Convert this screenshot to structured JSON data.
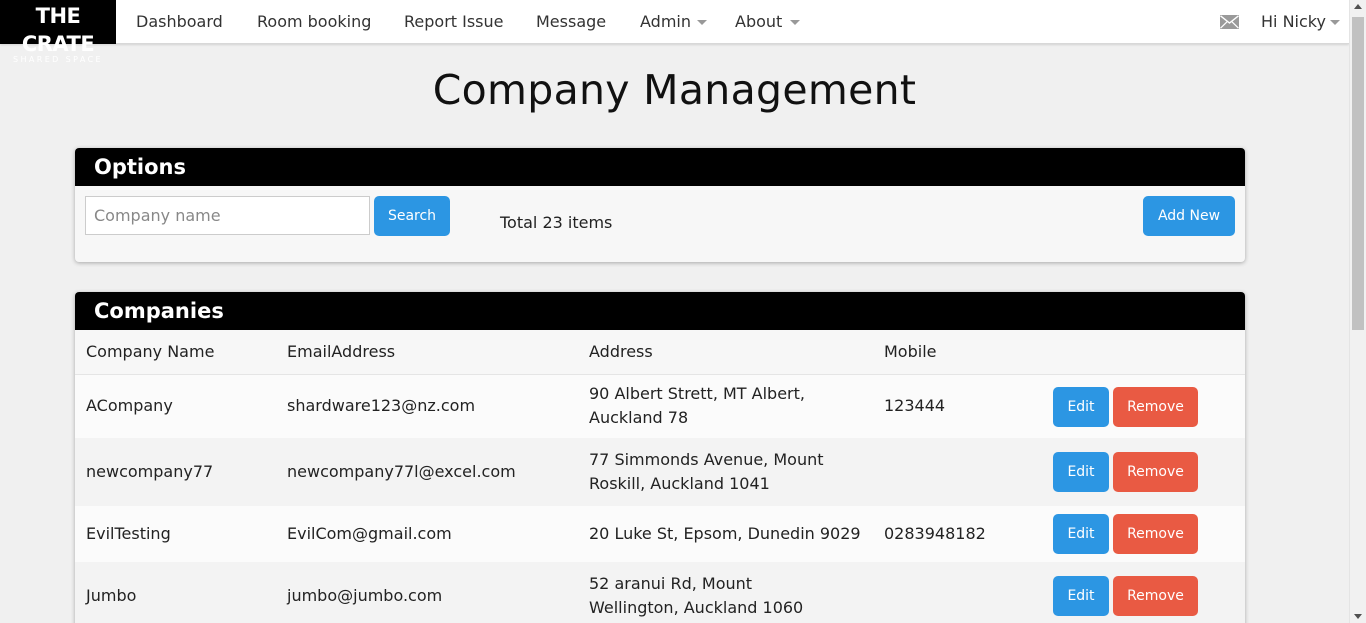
{
  "brand": {
    "line1": "THE CRATE",
    "line2": "SHARED SPACE"
  },
  "nav": {
    "items": [
      {
        "label": "Dashboard"
      },
      {
        "label": "Room booking"
      },
      {
        "label": "Report Issue"
      },
      {
        "label": "Message"
      },
      {
        "label": "Admin"
      },
      {
        "label": "About"
      }
    ],
    "greeting": "Hi Nicky"
  },
  "page": {
    "title": "Company Management"
  },
  "options": {
    "heading": "Options",
    "search_placeholder": "Company name",
    "search_value": "",
    "search_label": "Search",
    "total_text": "Total 23 items",
    "add_label": "Add New"
  },
  "companies": {
    "heading": "Companies",
    "columns": [
      "Company Name",
      "EmailAddress",
      "Address",
      "Mobile"
    ],
    "rows": [
      {
        "name": "ACompany",
        "email": "shardware123@nz.com",
        "address": "90 Albert Strett, MT Albert, Auckland 78",
        "mobile": "123444"
      },
      {
        "name": "newcompany77",
        "email": "newcompany77l@excel.com",
        "address": "77 Simmonds Avenue, Mount Roskill, Auckland 1041",
        "mobile": ""
      },
      {
        "name": "EvilTesting",
        "email": "EvilCom@gmail.com",
        "address": "20 Luke St, Epsom, Dunedin 9029",
        "mobile": "0283948182"
      },
      {
        "name": "Jumbo",
        "email": "jumbo@jumbo.com",
        "address": "52 aranui Rd, Mount Wellington, Auckland 1060",
        "mobile": ""
      }
    ],
    "edit_label": "Edit",
    "remove_label": "Remove"
  },
  "colors": {
    "primary": "#2c96e3",
    "danger": "#e95a43",
    "header_bg": "#000000"
  }
}
